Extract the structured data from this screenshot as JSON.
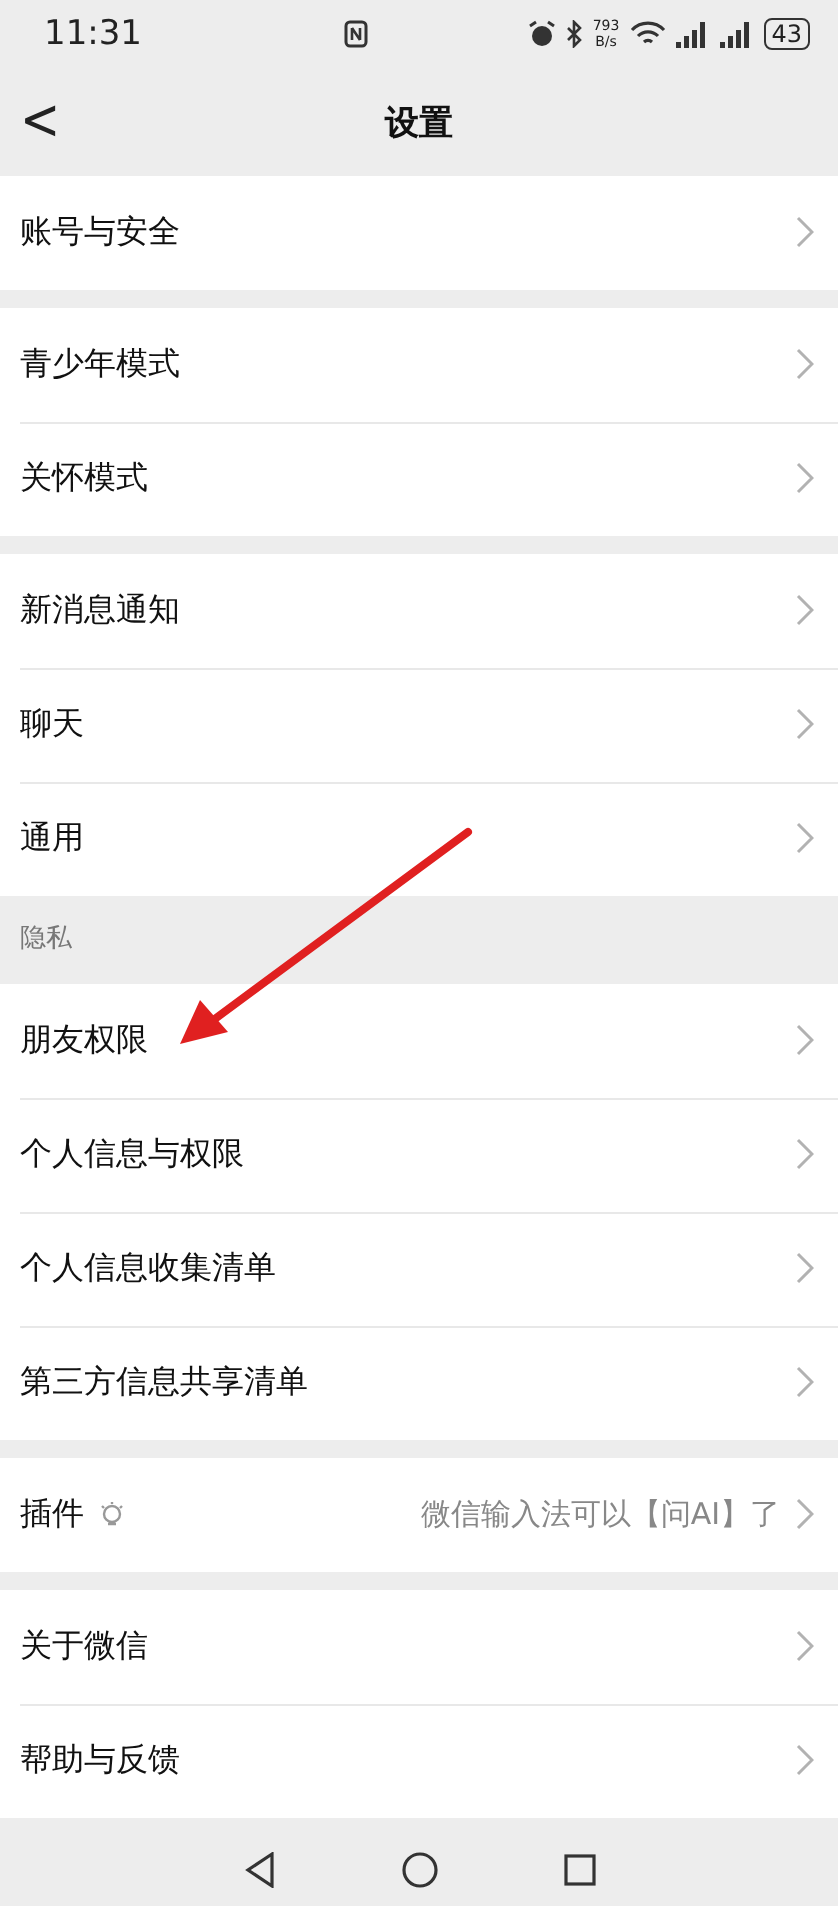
{
  "status_bar": {
    "time": "11:31",
    "net_speed": "793",
    "net_unit": "B/s",
    "battery": "43"
  },
  "nav": {
    "back": "<",
    "title": "设置"
  },
  "groups": [
    {
      "items": [
        {
          "label": "账号与安全"
        }
      ]
    },
    {
      "items": [
        {
          "label": "青少年模式"
        },
        {
          "label": "关怀模式"
        }
      ]
    },
    {
      "items": [
        {
          "label": "新消息通知"
        },
        {
          "label": "聊天"
        },
        {
          "label": "通用"
        }
      ]
    },
    {
      "header": "隐私",
      "items": [
        {
          "label": "朋友权限"
        },
        {
          "label": "个人信息与权限"
        },
        {
          "label": "个人信息收集清单"
        },
        {
          "label": "第三方信息共享清单"
        }
      ]
    },
    {
      "items": [
        {
          "label": "插件",
          "kind": "plugin",
          "value": "微信输入法可以【问AI】了"
        }
      ]
    },
    {
      "items": [
        {
          "label": "关于微信"
        },
        {
          "label": "帮助与反馈"
        }
      ]
    }
  ],
  "annotation": {
    "kind": "arrow"
  }
}
